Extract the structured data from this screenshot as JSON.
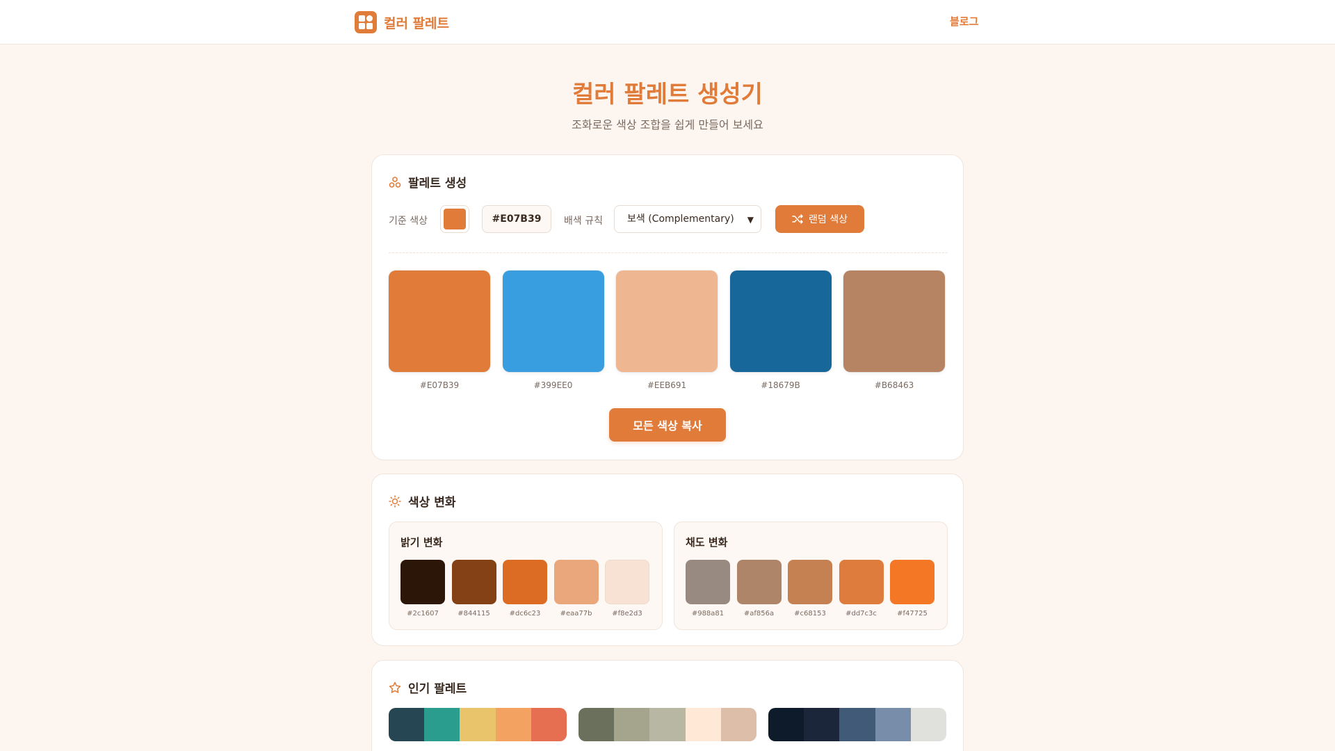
{
  "header": {
    "brand": "컬러 팔레트",
    "nav_blog": "블로그"
  },
  "hero": {
    "title": "컬러 팔레트 생성기",
    "subtitle": "조화로운 색상 조합을 쉽게 만들어 보세요"
  },
  "generator": {
    "title": "팔레트 생성",
    "base_label": "기준 색상",
    "base_color": "#E07B39",
    "hex_value": "#E07B39",
    "rule_label": "배색 규칙",
    "rule_selected": "보색 (Complementary)",
    "random_label": "랜덤 색상",
    "palette": [
      {
        "color": "#E07B39",
        "hex": "#E07B39"
      },
      {
        "color": "#399EE0",
        "hex": "#399EE0"
      },
      {
        "color": "#EEB691",
        "hex": "#EEB691"
      },
      {
        "color": "#18679B",
        "hex": "#18679B"
      },
      {
        "color": "#B68463",
        "hex": "#B68463"
      }
    ],
    "copy_all_label": "모든 색상 복사"
  },
  "variations": {
    "title": "색상 변화",
    "brightness": {
      "title": "밝기 변화",
      "colors": [
        {
          "color": "#2c1607",
          "hex": "#2c1607"
        },
        {
          "color": "#844115",
          "hex": "#844115"
        },
        {
          "color": "#dc6c23",
          "hex": "#dc6c23"
        },
        {
          "color": "#eaa77b",
          "hex": "#eaa77b"
        },
        {
          "color": "#f8e2d3",
          "hex": "#f8e2d3"
        }
      ]
    },
    "saturation": {
      "title": "채도 변화",
      "colors": [
        {
          "color": "#988a81",
          "hex": "#988a81"
        },
        {
          "color": "#af856a",
          "hex": "#af856a"
        },
        {
          "color": "#c68153",
          "hex": "#c68153"
        },
        {
          "color": "#dd7c3c",
          "hex": "#dd7c3c"
        },
        {
          "color": "#f47725",
          "hex": "#f47725"
        }
      ]
    }
  },
  "popular": {
    "title": "인기 팔레트",
    "palettes": [
      {
        "name": "",
        "colors": [
          "#264653",
          "#2a9d8f",
          "#e9c46a",
          "#f4a261",
          "#e76f51"
        ]
      },
      {
        "name": "",
        "colors": [
          "#6b705c",
          "#a5a58d",
          "#b7b7a4",
          "#ffe8d6",
          "#ddbea9"
        ]
      },
      {
        "name": "",
        "colors": [
          "#0d1b2a",
          "#1b263b",
          "#415a77",
          "#778da9",
          "#e0e1dd"
        ]
      }
    ]
  }
}
